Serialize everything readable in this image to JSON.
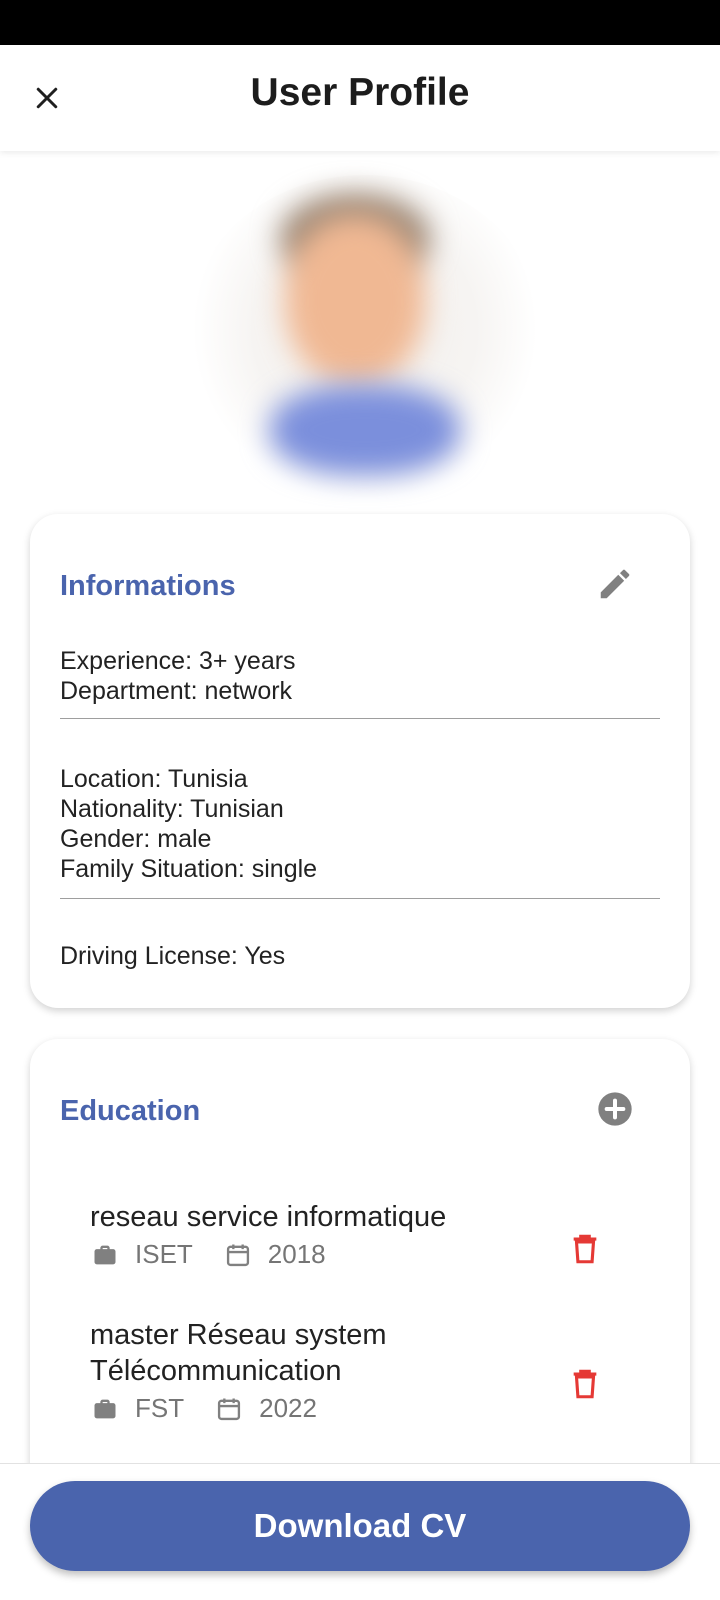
{
  "app_bar": {
    "title": "User Profile"
  },
  "profile": {
    "avatar_alt": "profile-photo"
  },
  "informations": {
    "title": "Informations",
    "group1": [
      "Experience: 3+ years",
      "Department: network"
    ],
    "group2": [
      "Location: Tunisia",
      "Nationality: Tunisian",
      "Gender: male",
      "Family Situation: single"
    ],
    "group3": [
      "Driving License: Yes"
    ]
  },
  "education": {
    "title": "Education",
    "items": [
      {
        "degree": "reseau service informatique",
        "institution": "ISET",
        "year": "2018"
      },
      {
        "degree_line1": "master Réseau system",
        "degree_line2": "Télécommunication",
        "institution": "FST",
        "year": "2022"
      }
    ]
  },
  "actions": {
    "download_cv": "Download CV"
  },
  "colors": {
    "accent": "#4a64ad",
    "delete": "#e53935",
    "icon_gray": "#808080"
  }
}
